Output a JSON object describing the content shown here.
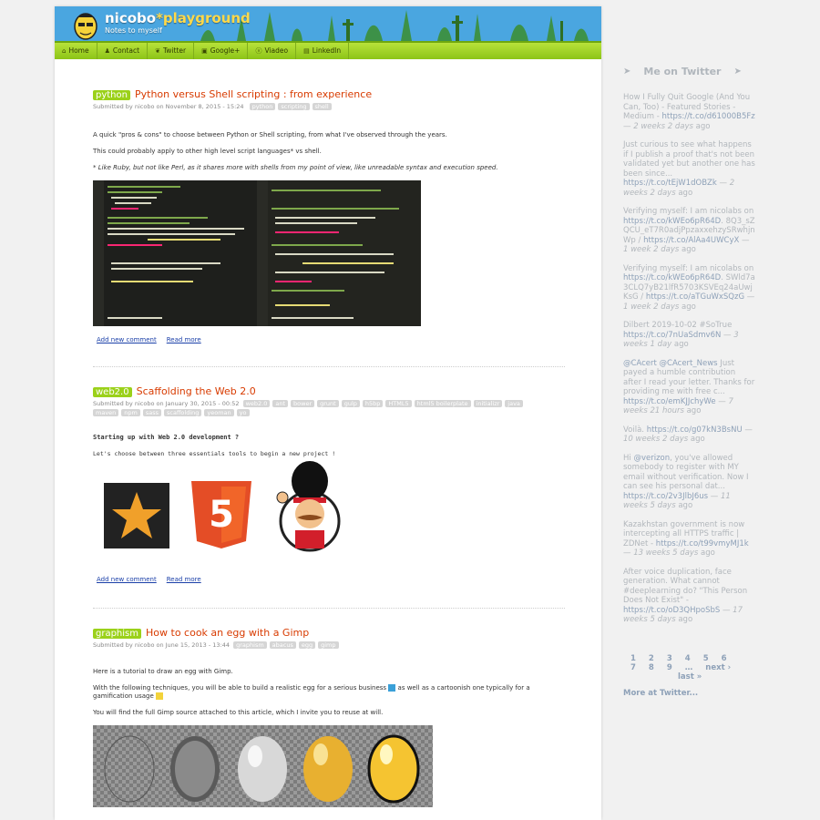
{
  "site": {
    "name_part1": "nicobo",
    "name_star": "*",
    "name_part2": "playground",
    "tagline": "Notes to myself"
  },
  "nav": [
    {
      "label": "Home",
      "icon": "home-icon"
    },
    {
      "label": "Contact",
      "icon": "person-icon"
    },
    {
      "label": "Twitter",
      "icon": "twitter-icon"
    },
    {
      "label": "Google+",
      "icon": "google-plus-icon"
    },
    {
      "label": "Viadeo",
      "icon": "viadeo-icon"
    },
    {
      "label": "LinkedIn",
      "icon": "linkedin-icon"
    }
  ],
  "posts": [
    {
      "category": "python",
      "title": "Python versus Shell scripting : from experience",
      "meta": "Submitted by nicobo on November 8, 2015 - 15:24",
      "tags": [
        "python",
        "scripting",
        "shell"
      ],
      "p1": "A quick \"pros & cons\" to choose between Python or Shell scripting, from what I've observed through the years.",
      "p2": "This could probably apply to other  high level script languages* vs shell.",
      "p3": "* Like Ruby, but not like Perl, as it shares more with shells from my point of view, like  unreadable  syntax and execution speed.",
      "link_comment": "Add new comment",
      "link_more": "Read more"
    },
    {
      "category": "web2.0",
      "title": "Scaffolding the Web 2.0",
      "meta": "Submitted by nicobo on January 30, 2015 - 00:52",
      "tags": [
        "web2.0",
        "ant",
        "bower",
        "grunt",
        "gulp",
        "h5bp",
        "HTML5",
        "html5 boilerplate",
        "initializr",
        "java",
        "maven",
        "npm",
        "sass",
        "scaffolding",
        "yeoman",
        "yo"
      ],
      "heading": "Starting up with Web 2.0 development ?",
      "p1": "Let's choose between three essentials tools to begin a new project !",
      "link_comment": "Add new comment",
      "link_more": "Read more"
    },
    {
      "category": "graphism",
      "title": "How to cook an egg with a Gimp",
      "meta": "Submitted by nicobo on June 15, 2013 - 13:44",
      "tags": [
        "graphism",
        "abacus",
        "egg",
        "gimp"
      ],
      "p1": "Here is a tutorial to draw an egg with Gimp.",
      "p2a": "With the following techniques, you  will be able to build a realistic egg  for a serious business",
      "p2b": "as well as a cartoonish one typically for a gamification usage",
      "p3": "You will find the full Gimp source attached to this article, which I invite you to reuse at will."
    }
  ],
  "sidebar": {
    "title": "Me on Twitter",
    "tweets": [
      {
        "text": "How I Fully Quit Google (And You Can, Too) - Featured Stories - Medium - ",
        "link": "https://t.co/d61000B5Fz",
        "age": "2 weeks 2 days",
        "suffix": " ago"
      },
      {
        "text": "Just curious to see what happens if I publish a proof that's not been validated yet but another one has been since... ",
        "link": "https://t.co/tEjW1dOBZk",
        "age": "2 weeks 2 days",
        "suffix": " ago"
      },
      {
        "text": "Verifying myself: I am nicolabs on ",
        "link": "https://t.co/kWEo6pR64D",
        "text2": ". 8Q3_sZQCU_eT7R0adjPpzaxxehzySRwhjnWp / ",
        "link2": "https://t.co/AlAa4UWCyX",
        "age": "1 week 2 days",
        "suffix": " ago"
      },
      {
        "text": "Verifying myself: I am nicolabs on ",
        "link": "https://t.co/kWEo6pR64D",
        "text2": ". SWld7a3CLQ7yB21lfR5703KSVEq24aUwjKsG / ",
        "link2": "https://t.co/aTGuWxSQzG",
        "age": "1 week 2 days",
        "suffix": " ago"
      },
      {
        "text": "Dilbert 2019-10-02 #SoTrue ",
        "link": "https://t.co/7nUaSdmv6N",
        "age": "3 weeks 1 day",
        "suffix": " ago"
      },
      {
        "text_link": "@CAcert",
        "text_link2": "@CAcert_News",
        "text": " Just payed a humble contribution after I read your letter. Thanks for providing me with free c... ",
        "link": "https://t.co/emKJJchyWe",
        "age": "7 weeks 21 hours",
        "suffix": " ago"
      },
      {
        "text": "Voilà. ",
        "link": "https://t.co/g07kN3BsNU",
        "age": "10 weeks 2 days",
        "suffix": " ago"
      },
      {
        "text": "Hi ",
        "text_link": "@verizon",
        "text2": ", you've allowed somebody to register with MY email without verification. Now I can see his personal dat... ",
        "link": "https://t.co/2v3JlbJ6us",
        "age": "11 weeks 5 days",
        "suffix": " ago"
      },
      {
        "text": "Kazakhstan government is now intercepting all HTTPS traffic | ZDNet - ",
        "link": "https://t.co/t99vmyMJ1k",
        "age": "13 weeks 5 days",
        "suffix": " ago"
      },
      {
        "text": "After voice duplication, face generation. What cannot #deeplearning do? \"This Person Does Not Exist\" - ",
        "link": "https://t.co/oD3QHpoSbS",
        "age": "17 weeks 5 days",
        "suffix": " ago"
      }
    ],
    "pager": [
      "1",
      "2",
      "3",
      "4",
      "5",
      "6",
      "7",
      "8",
      "9",
      "…",
      "next ›",
      "last »"
    ],
    "more": "More at Twitter..."
  },
  "colors": {
    "accent_green": "#9bd11a",
    "title_red": "#d83b01",
    "banner_blue": "#4aa6e0",
    "sidebar_link": "#8ea1b8"
  }
}
